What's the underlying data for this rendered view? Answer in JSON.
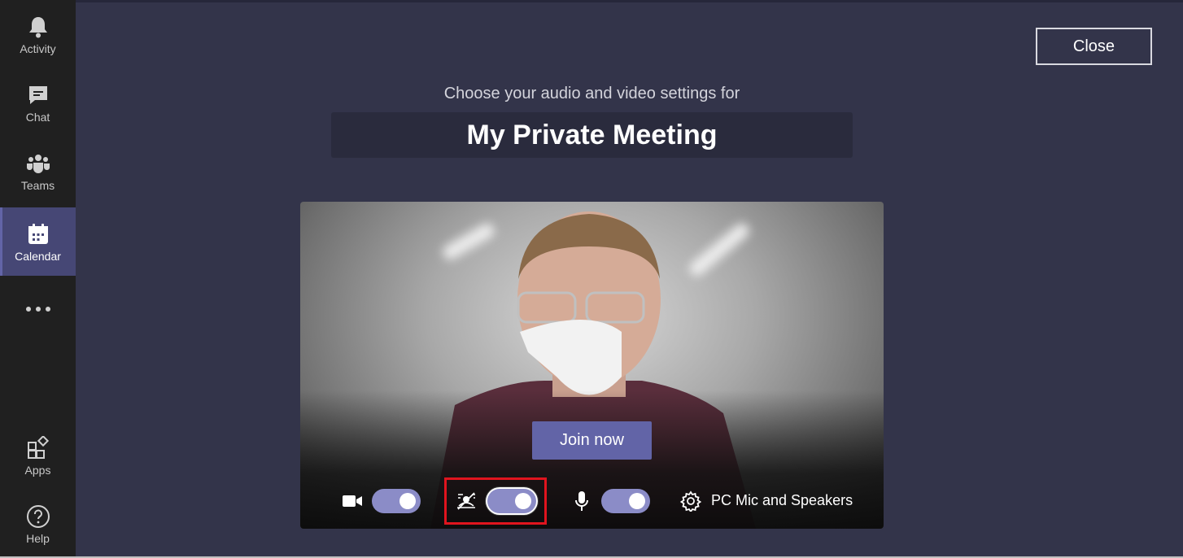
{
  "rail": {
    "items": [
      {
        "label": "Activity",
        "icon": "bell-icon"
      },
      {
        "label": "Chat",
        "icon": "chat-icon"
      },
      {
        "label": "Teams",
        "icon": "teams-icon"
      },
      {
        "label": "Calendar",
        "icon": "calendar-icon",
        "active": true
      }
    ],
    "more_icon": "more-icon",
    "bottom": [
      {
        "label": "Apps",
        "icon": "apps-icon"
      },
      {
        "label": "Help",
        "icon": "help-icon"
      }
    ]
  },
  "header": {
    "close_label": "Close",
    "subtitle": "Choose your audio and video settings for",
    "meeting_title": "My Private Meeting"
  },
  "preview": {
    "join_label": "Join now",
    "camera_on": true,
    "background_blur_on": true,
    "microphone_on": true,
    "device_label": "PC Mic and Speakers"
  },
  "colors": {
    "accent": "#6264a7",
    "toggle_on": "#8b8cc7",
    "highlight": "#e0141e"
  }
}
